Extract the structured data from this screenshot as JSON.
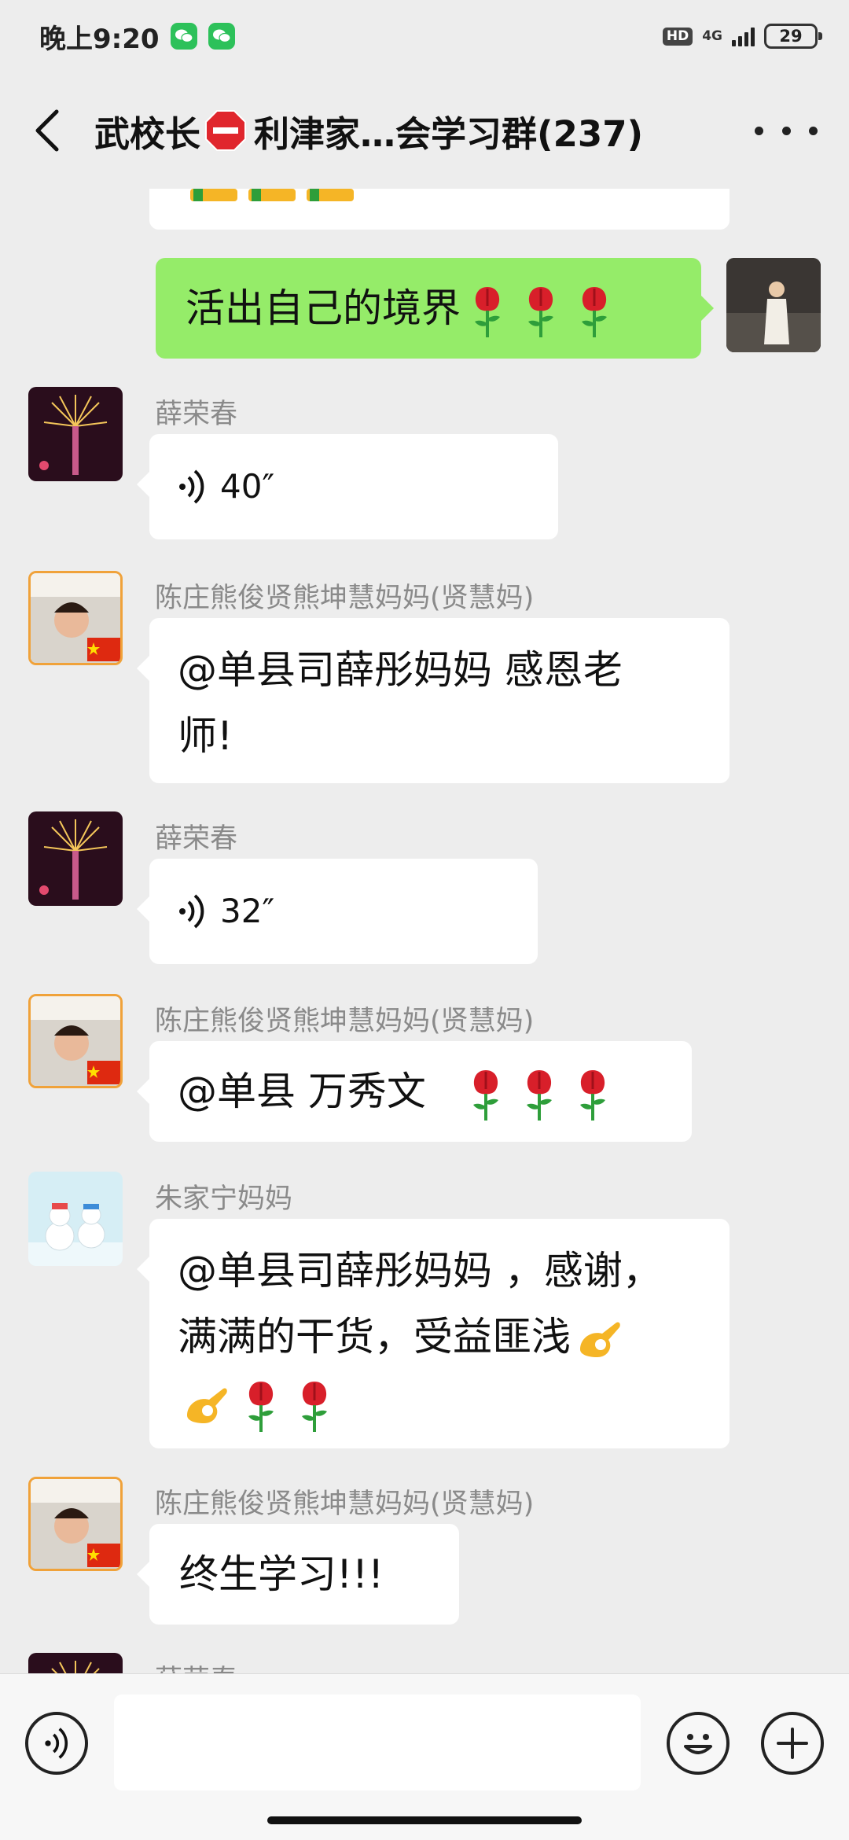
{
  "status_bar": {
    "time": "晚上9:20",
    "hd": "HD",
    "network": "4G",
    "battery": "29"
  },
  "header": {
    "title_part1": "武校长",
    "title_part2": "利津家…会学习群(237)",
    "back_icon": "chevron-left-icon",
    "more_icon": "more-dots-icon"
  },
  "messages": [
    {
      "type": "self",
      "text": "活出自己的境界",
      "emoji": [
        "rose",
        "rose",
        "rose"
      ]
    },
    {
      "sender": "薛荣春",
      "type": "voice",
      "duration": "40″"
    },
    {
      "sender": "陈庄熊俊贤熊坤慧妈妈(贤慧妈)",
      "type": "text",
      "line1": "@单县司薛彤妈妈  感恩老",
      "line2": "师!"
    },
    {
      "sender": "薛荣春",
      "type": "voice",
      "duration": "32″"
    },
    {
      "sender": "陈庄熊俊贤熊坤慧妈妈(贤慧妈)",
      "type": "text",
      "line1": "@单县  万秀文",
      "emoji": [
        "rose",
        "rose",
        "rose"
      ]
    },
    {
      "sender": "朱家宁妈妈",
      "type": "text",
      "line1": "@单县司薛彤妈妈 ，感谢，",
      "line2": "满满的干货，受益匪浅",
      "line3_emoji": [
        "ok-hand",
        "rose",
        "rose"
      ]
    },
    {
      "sender": "陈庄熊俊贤熊坤慧妈妈(贤慧妈)",
      "type": "text",
      "line1": "终生学习!!!"
    },
    {
      "sender": "薛荣春",
      "type": "partial"
    }
  ],
  "colors": {
    "background": "#ededed",
    "self_bubble": "#95ec69",
    "other_bubble": "#ffffff",
    "sender_name": "#8a8a8a"
  }
}
